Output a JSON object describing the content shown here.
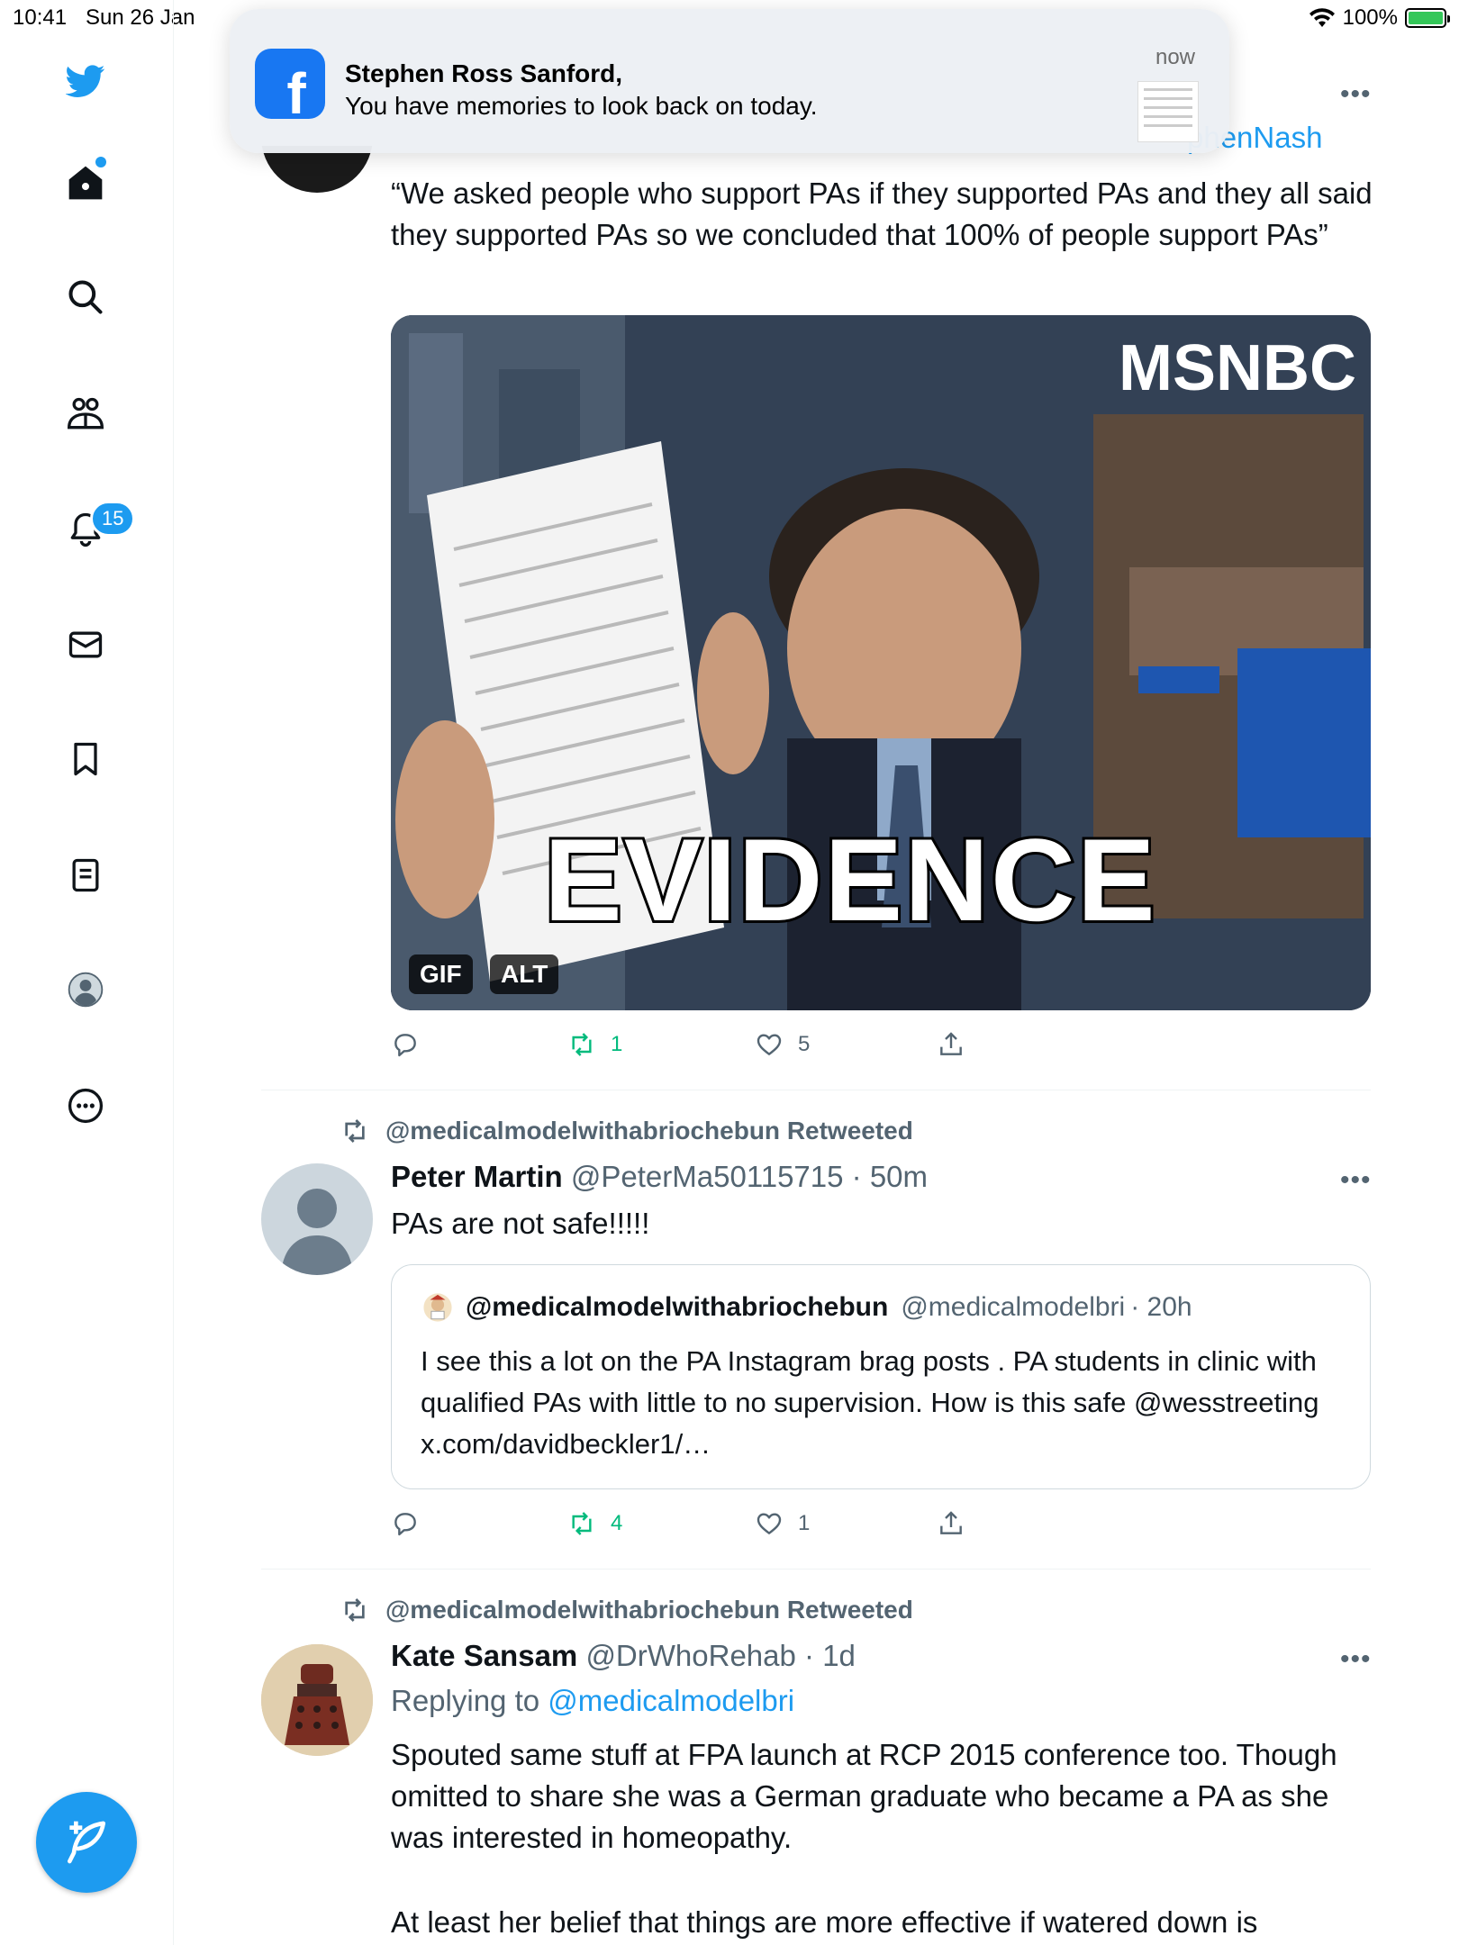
{
  "status_bar": {
    "time": "10:41",
    "date": "Sun 26 Jan",
    "battery": "100%"
  },
  "sidebar": {
    "notification_count": "15"
  },
  "notification": {
    "app": "Facebook",
    "title": "Stephen Ross Sanford,",
    "body": "You have memories to look back on today.",
    "time": "now"
  },
  "tweet1": {
    "reply_fragment": "phenNash",
    "text": "“We asked people who support PAs if they supported PAs and they all said they supported PAs so we concluded that 100% of people support PAs”",
    "media": {
      "overlay_text": "EVIDENCE",
      "network_logo": "MSNBC",
      "gif_label": "GIF",
      "alt_label": "ALT"
    },
    "retweets": "1",
    "likes": "5"
  },
  "tweet2": {
    "retweeted_by": "@medicalmodelwithabriochebun Retweeted",
    "name": "Peter Martin",
    "handle": "@PeterMa50115715",
    "time": "· 50m",
    "text": "PAs are not safe!!!!!",
    "quote": {
      "name": "@medicalmodelwithabriochebun",
      "handle": "@medicalmodelbri",
      "time": "· 20h",
      "text": "I see this a lot on the PA Instagram brag posts . PA students in clinic with qualified PAs with little to no supervision. How is this safe @wesstreeting x.com/davidbeckler1/…"
    },
    "retweets": "4",
    "likes": "1"
  },
  "tweet3": {
    "retweeted_by": "@medicalmodelwithabriochebun Retweeted",
    "name": "Kate Sansam",
    "handle": "@DrWhoRehab",
    "time": "· 1d",
    "replying_to_label": "Replying to",
    "replying_to_handle": "@medicalmodelbri",
    "text_p1": "Spouted same stuff at FPA launch at RCP 2015 conference too. Though omitted to share she was a German graduate who became a PA as she was interested in homeopathy.",
    "text_p2": "At least her belief that things are more effective if watered down is"
  },
  "colors": {
    "accent": "#1d9bf0",
    "retweet_green": "#00ba7c",
    "facebook_blue": "#1877f2",
    "battery_green": "#34c759"
  }
}
